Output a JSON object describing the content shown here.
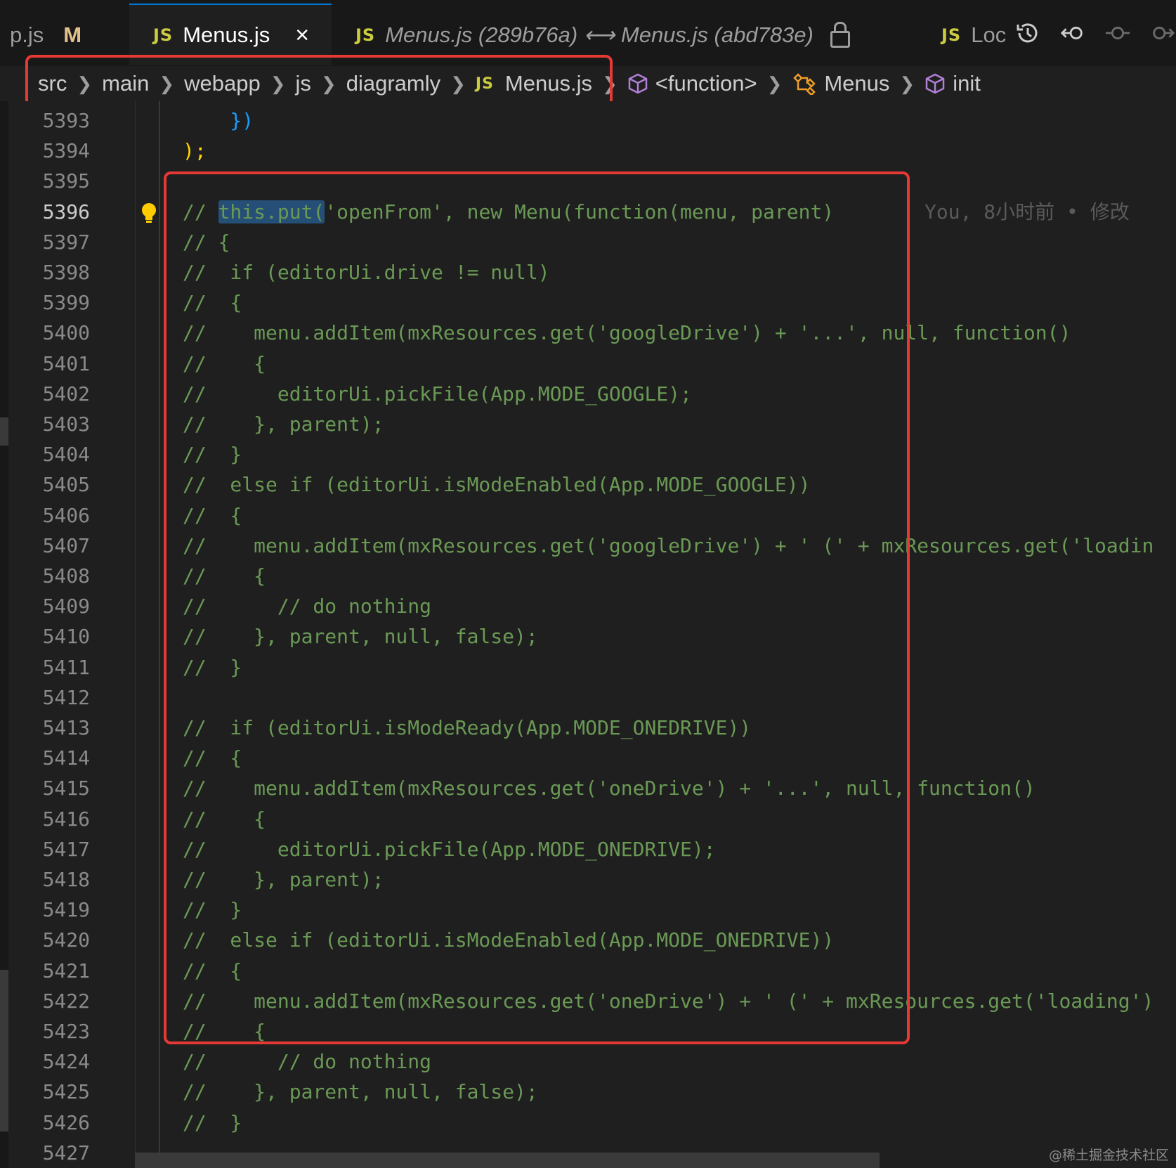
{
  "tabs": [
    {
      "label": "p.js",
      "modified": "M"
    },
    {
      "label": "Menus.js",
      "badge": "JS",
      "close": "×"
    },
    {
      "label": "Menus.js (289b76a) ⟷ Menus.js (abd783e)",
      "badge": "JS"
    },
    {
      "label": "Loc",
      "badge": "JS"
    }
  ],
  "toolbar": {
    "icons": [
      "history-icon",
      "go-back-icon",
      "go-to-commit-icon",
      "go-forward-icon"
    ]
  },
  "breadcrumb": {
    "items": [
      "src",
      "main",
      "webapp",
      "js",
      "diagramly",
      "Menus.js",
      "<function>",
      "Menus",
      "init"
    ],
    "file_badge": "JS"
  },
  "editor": {
    "blame": "You, 8小时前 • 修改",
    "watermark": "@稀土掘金技术社区",
    "highlight_color": "#e53935",
    "lines": [
      {
        "n": "5393",
        "code": "    })"
      },
      {
        "n": "5394",
        "code": ");"
      },
      {
        "n": "5395",
        "code": ""
      },
      {
        "n": "5396",
        "code": "// this.put('openFrom', new Menu(function(menu, parent)"
      },
      {
        "n": "5397",
        "code": "// {"
      },
      {
        "n": "5398",
        "code": "//  if (editorUi.drive != null)"
      },
      {
        "n": "5399",
        "code": "//  {"
      },
      {
        "n": "5400",
        "code": "//    menu.addItem(mxResources.get('googleDrive') + '...', null, function()"
      },
      {
        "n": "5401",
        "code": "//    {"
      },
      {
        "n": "5402",
        "code": "//      editorUi.pickFile(App.MODE_GOOGLE);"
      },
      {
        "n": "5403",
        "code": "//    }, parent);"
      },
      {
        "n": "5404",
        "code": "//  }"
      },
      {
        "n": "5405",
        "code": "//  else if (editorUi.isModeEnabled(App.MODE_GOOGLE))"
      },
      {
        "n": "5406",
        "code": "//  {"
      },
      {
        "n": "5407",
        "code": "//    menu.addItem(mxResources.get('googleDrive') + ' (' + mxResources.get('loadin"
      },
      {
        "n": "5408",
        "code": "//    {"
      },
      {
        "n": "5409",
        "code": "//      // do nothing"
      },
      {
        "n": "5410",
        "code": "//    }, parent, null, false);"
      },
      {
        "n": "5411",
        "code": "//  }"
      },
      {
        "n": "5412",
        "code": ""
      },
      {
        "n": "5413",
        "code": "//  if (editorUi.isModeReady(App.MODE_ONEDRIVE))"
      },
      {
        "n": "5414",
        "code": "//  {"
      },
      {
        "n": "5415",
        "code": "//    menu.addItem(mxResources.get('oneDrive') + '...', null, function()"
      },
      {
        "n": "5416",
        "code": "//    {"
      },
      {
        "n": "5417",
        "code": "//      editorUi.pickFile(App.MODE_ONEDRIVE);"
      },
      {
        "n": "5418",
        "code": "//    }, parent);"
      },
      {
        "n": "5419",
        "code": "//  }"
      },
      {
        "n": "5420",
        "code": "//  else if (editorUi.isModeEnabled(App.MODE_ONEDRIVE))"
      },
      {
        "n": "5421",
        "code": "//  {"
      },
      {
        "n": "5422",
        "code": "//    menu.addItem(mxResources.get('oneDrive') + ' (' + mxResources.get('loading')"
      },
      {
        "n": "5423",
        "code": "//    {"
      },
      {
        "n": "5424",
        "code": "//      // do nothing"
      },
      {
        "n": "5425",
        "code": "//    }, parent, null, false);"
      },
      {
        "n": "5426",
        "code": "//  }"
      },
      {
        "n": "5427",
        "code": ""
      }
    ]
  }
}
